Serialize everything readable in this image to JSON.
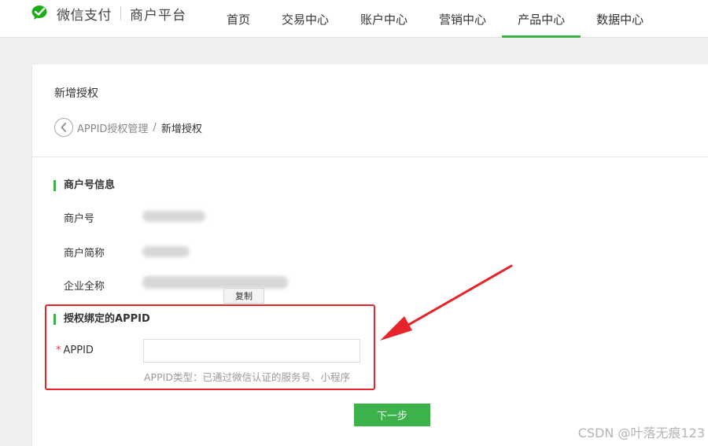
{
  "brand": {
    "name": "微信支付",
    "sub": "商户平台"
  },
  "nav": [
    {
      "label": "首页",
      "active": false
    },
    {
      "label": "交易中心",
      "active": false
    },
    {
      "label": "账户中心",
      "active": false
    },
    {
      "label": "营销中心",
      "active": false
    },
    {
      "label": "产品中心",
      "active": true
    },
    {
      "label": "数据中心",
      "active": false
    }
  ],
  "page": {
    "title": "新增授权",
    "breadcrumb": {
      "parent": "APPID授权管理",
      "separator": "/",
      "current": "新增授权"
    }
  },
  "merchant_info": {
    "section_title": "商户号信息",
    "fields": [
      {
        "label": "商户号"
      },
      {
        "label": "商户简称"
      },
      {
        "label": "企业全称"
      }
    ],
    "copy_label": "复制"
  },
  "appid_section": {
    "section_title": "授权绑定的APPID",
    "required_mark": "*",
    "field_label": "APPID",
    "value": "",
    "hint": "APPID类型：已通过微信认证的服务号、小程序"
  },
  "next_button": "下一步",
  "watermark": "CSDN @叶落无痕123",
  "colors": {
    "accent": "#3eb24a",
    "annotation": "#e8242b"
  }
}
